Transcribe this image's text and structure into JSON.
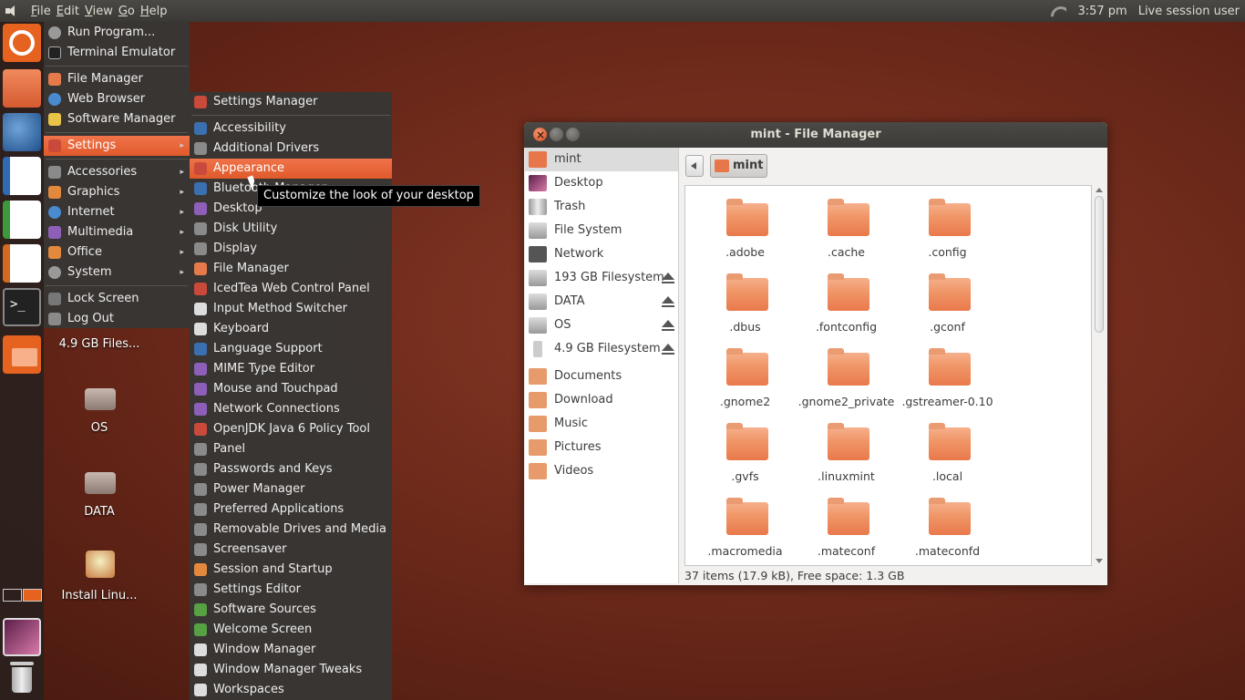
{
  "top_panel": {
    "menus": [
      "File",
      "Edit",
      "View",
      "Go",
      "Help"
    ],
    "clock": "3:57 pm",
    "user": "Live session user"
  },
  "main_menu": {
    "group1": [
      "Run Program...",
      "Terminal Emulator"
    ],
    "group2": [
      "File Manager",
      "Web Browser",
      "Software Manager"
    ],
    "settings": "Settings",
    "categories": [
      "Accessories",
      "Graphics",
      "Internet",
      "Multimedia",
      "Office",
      "System"
    ],
    "group4": [
      "Lock Screen",
      "Log Out"
    ]
  },
  "settings_menu": {
    "header": "Settings Manager",
    "items": [
      "Accessibility",
      "Additional Drivers",
      "Appearance",
      "Bluetooth Manager",
      "Desktop",
      "Disk Utility",
      "Display",
      "File Manager",
      "IcedTea Web Control Panel",
      "Input Method Switcher",
      "Keyboard",
      "Language Support",
      "MIME Type Editor",
      "Mouse and Touchpad",
      "Network Connections",
      "OpenJDK Java 6 Policy Tool",
      "Panel",
      "Passwords and Keys",
      "Power Manager",
      "Preferred Applications",
      "Removable Drives and Media",
      "Screensaver",
      "Session and Startup",
      "Settings Editor",
      "Software Sources",
      "Welcome Screen",
      "Window Manager",
      "Window Manager Tweaks",
      "Workspaces"
    ],
    "active": "Appearance"
  },
  "tooltip": "Customize the look of your desktop",
  "desktop": {
    "icons": [
      "4.9 GB Files...",
      "OS",
      "DATA",
      "Install Linu..."
    ]
  },
  "file_manager": {
    "title": "mint - File Manager",
    "places": [
      "mint",
      "Desktop",
      "Trash",
      "File System",
      "Network"
    ],
    "devices": [
      "193 GB Filesystem",
      "DATA",
      "OS",
      "4.9 GB Filesystem"
    ],
    "bookmarks": [
      "Documents",
      "Download",
      "Music",
      "Pictures",
      "Videos"
    ],
    "breadcrumb": "mint",
    "files": [
      ".adobe",
      ".cache",
      ".config",
      ".dbus",
      ".fontconfig",
      ".gconf",
      ".gnome2",
      ".gnome2_private",
      ".gstreamer-0.10",
      ".gvfs",
      ".linuxmint",
      ".local",
      ".macromedia",
      ".mateconf",
      ".mateconfd"
    ],
    "status": "37 items (17.9 kB), Free space: 1.3 GB"
  },
  "colors": {
    "accent": "#e05a2b",
    "folder": "#f09768",
    "panel": "#3c3b37"
  }
}
